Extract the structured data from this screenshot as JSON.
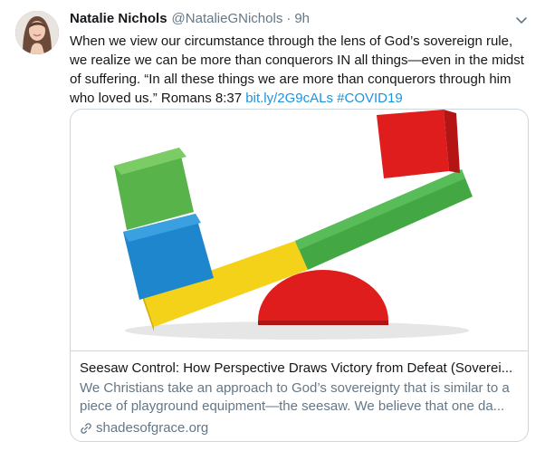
{
  "tweet": {
    "author_name": "Natalie Nichols",
    "author_handle": "@NatalieGNichols",
    "separator": "·",
    "time": "9h",
    "text_before_link": "When we view our circumstance through the lens of God’s sovereign rule, we realize we can be more than conquerors IN all things—even in the midst of suffering. “In all these things we are more than conquerors through him who loved us.” Romans 8:37 ",
    "link": "bit.ly/2G9cALs",
    "hashtag": "#COVID19"
  },
  "card": {
    "title": "Seesaw Control: How Perspective Draws Victory from Defeat (Soverei...",
    "description": "We Christians take an approach to God’s sovereignty that is similar to a piece of playground equipment—the seesaw. We believe that one da...",
    "domain": "shadesofgrace.org"
  },
  "icons": {
    "caret": "chevron-down-icon",
    "link": "link-icon"
  },
  "colors": {
    "link": "#1b95e0",
    "secondary_text": "#657786",
    "border": "#ccd6dd"
  }
}
